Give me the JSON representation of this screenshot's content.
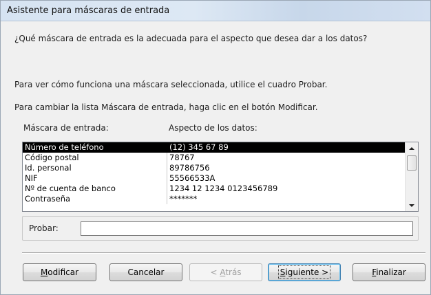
{
  "window": {
    "title": "Asistente para máscaras de entrada"
  },
  "content": {
    "question": "¿Qué máscara de entrada es la adecuada para el aspecto que desea dar a los datos?",
    "instruction_test": "Para ver cómo funciona una máscara seleccionada, utilice el cuadro Probar.",
    "instruction_modify": "Para cambiar la lista Máscara de entrada, haga clic en el botón Modificar.",
    "column_mask": "Máscara de entrada:",
    "column_aspect": "Aspecto de los datos:"
  },
  "masks": [
    {
      "name": "Número de teléfono",
      "aspect": "(12) 345 67 89",
      "selected": true
    },
    {
      "name": "Código postal",
      "aspect": "78767",
      "selected": false
    },
    {
      "name": "Id. personal",
      "aspect": "89786756",
      "selected": false
    },
    {
      "name": "NIF",
      "aspect": "55566533A",
      "selected": false
    },
    {
      "name": "Nº de cuenta de banco",
      "aspect": "1234 12 1234 0123456789",
      "selected": false
    },
    {
      "name": "Contraseña",
      "aspect": "*******",
      "selected": false
    }
  ],
  "test": {
    "label": "Probar:",
    "value": ""
  },
  "buttons": {
    "modify": {
      "mnemonic": "M",
      "rest": "odificar"
    },
    "cancel": "Cancelar",
    "back": {
      "prefix": "< ",
      "mnemonic": "A",
      "rest": "trás"
    },
    "next": {
      "mnemonic": "S",
      "rest": "iguiente >"
    },
    "finish": {
      "mnemonic": "F",
      "rest": "inalizar"
    }
  },
  "colors": {
    "selected_row_bg": "#000000",
    "selected_row_fg": "#ffffff"
  }
}
